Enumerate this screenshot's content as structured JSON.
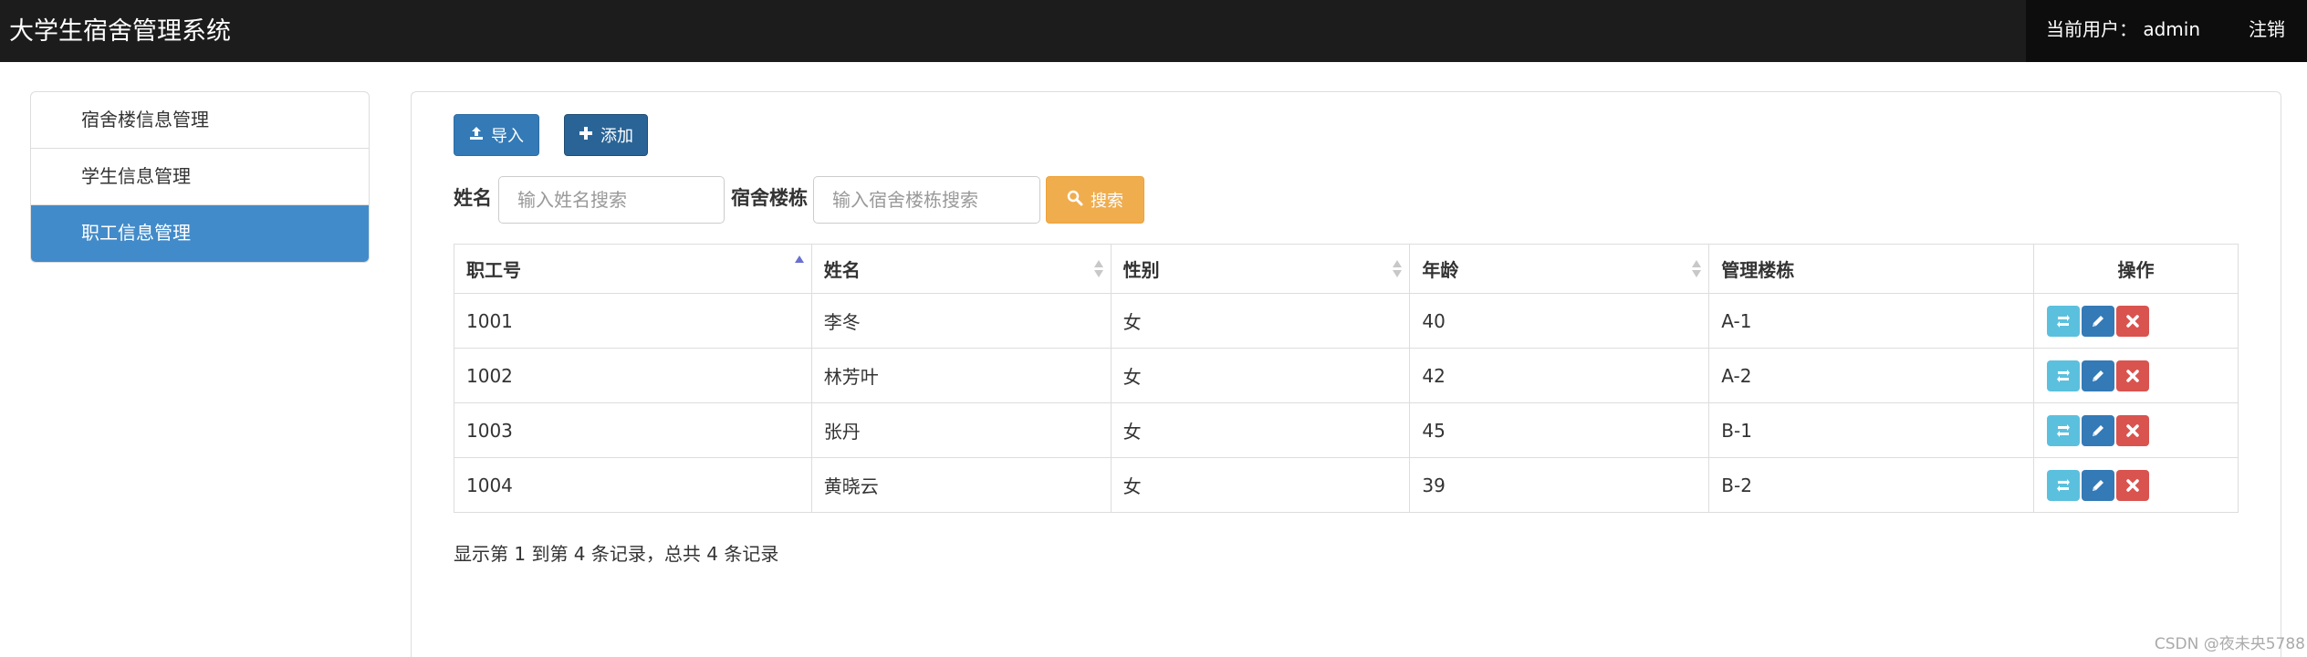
{
  "app": {
    "title": "大学生宿舍管理系统"
  },
  "header": {
    "user_label": "当前用户： admin",
    "logout_label": "注销"
  },
  "sidebar": {
    "items": [
      {
        "label": "宿舍楼信息管理",
        "active": false
      },
      {
        "label": "学生信息管理",
        "active": false
      },
      {
        "label": "职工信息管理",
        "active": true
      }
    ]
  },
  "toolbar": {
    "import_label": "导入",
    "add_label": "添加"
  },
  "search": {
    "name_label": "姓名",
    "name_placeholder": "输入姓名搜索",
    "building_label": "宿舍楼栋",
    "building_placeholder": "输入宿舍楼栋搜索",
    "button_label": "搜索"
  },
  "table": {
    "columns": [
      "职工号",
      "姓名",
      "性别",
      "年龄",
      "管理楼栋",
      "操作"
    ],
    "rows": [
      [
        "1001",
        "李冬",
        "女",
        "40",
        "A-1"
      ],
      [
        "1002",
        "林芳叶",
        "女",
        "42",
        "A-2"
      ],
      [
        "1003",
        "张丹",
        "女",
        "45",
        "B-1"
      ],
      [
        "1004",
        "黄晓云",
        "女",
        "39",
        "B-2"
      ]
    ],
    "row_actions": [
      "refresh-icon",
      "pencil-icon",
      "close-icon"
    ]
  },
  "pagination": {
    "summary": "显示第 1 到第 4 条记录，总共 4 条记录"
  },
  "watermark": "CSDN @夜未央5788",
  "colors": {
    "navbar": "#1c1c1c",
    "primary": "#337ab7",
    "sidebar_active": "#428bca",
    "warning": "#f0ad4e",
    "info": "#5bc0de",
    "danger": "#d9534f"
  }
}
